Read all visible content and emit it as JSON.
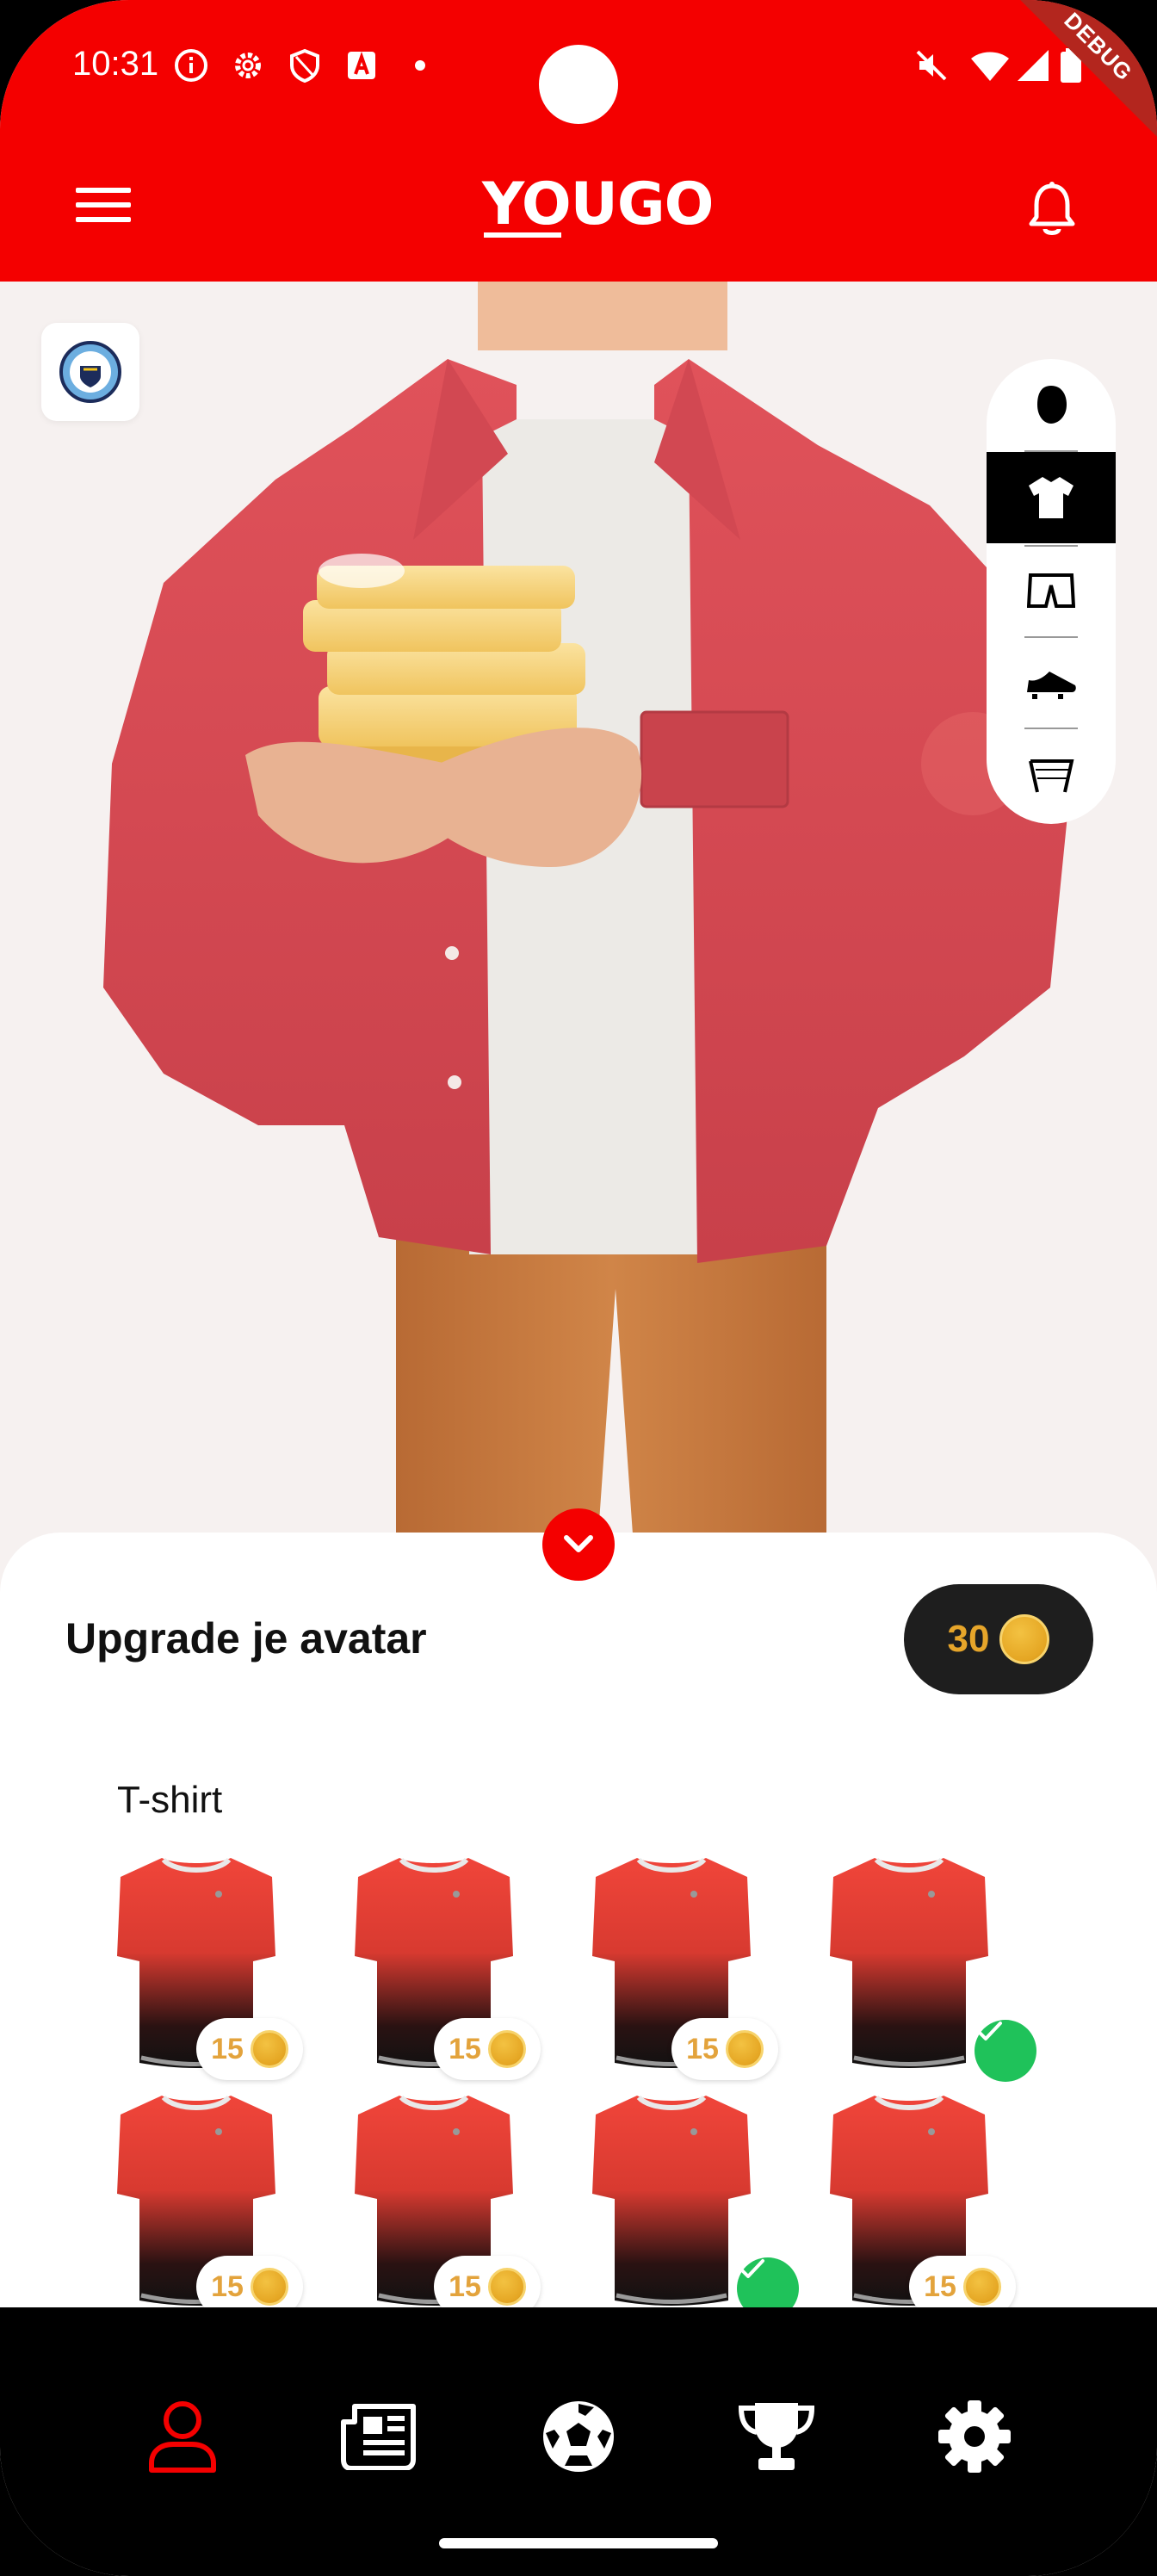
{
  "status_bar": {
    "time": "10:31",
    "icons": [
      "info-icon",
      "settings-icon",
      "shield-icon",
      "font-a-icon",
      "dot-icon",
      "mute-icon",
      "wifi-icon",
      "signal-icon",
      "battery-icon"
    ]
  },
  "debug_banner": "DEBUG",
  "app_bar": {
    "logo": "YOUGO",
    "left_icon": "menu-icon",
    "right_icon": "bell-icon"
  },
  "club_badge_icon": "manchester-city-crest-icon",
  "category_rail": [
    {
      "icon": "head-icon",
      "active": false
    },
    {
      "icon": "t-shirt-icon",
      "active": true
    },
    {
      "icon": "shorts-icon",
      "active": false
    },
    {
      "icon": "football-boot-icon",
      "active": false
    },
    {
      "icon": "goal-icon",
      "active": false
    }
  ],
  "sheet": {
    "title": "Upgrade je avatar",
    "coin_balance": "30",
    "section_label": "T-shirt",
    "items": [
      {
        "price": "15",
        "owned": false
      },
      {
        "price": "15",
        "owned": false
      },
      {
        "price": "15",
        "owned": false
      },
      {
        "price": "",
        "owned": true
      },
      {
        "price": "15",
        "owned": false
      },
      {
        "price": "15",
        "owned": false
      },
      {
        "price": "",
        "owned": true
      },
      {
        "price": "15",
        "owned": false
      }
    ]
  },
  "bottom_nav": [
    {
      "icon": "user-icon",
      "active": true
    },
    {
      "icon": "news-icon",
      "active": false
    },
    {
      "icon": "football-icon",
      "active": false
    },
    {
      "icon": "trophy-icon",
      "active": false
    },
    {
      "icon": "settings-gear-icon",
      "active": false
    }
  ],
  "colors": {
    "brand_red": "#f40000",
    "coin_gold": "#e5a623",
    "owned_green": "#1fc25a",
    "nav_active": "#f40000"
  }
}
